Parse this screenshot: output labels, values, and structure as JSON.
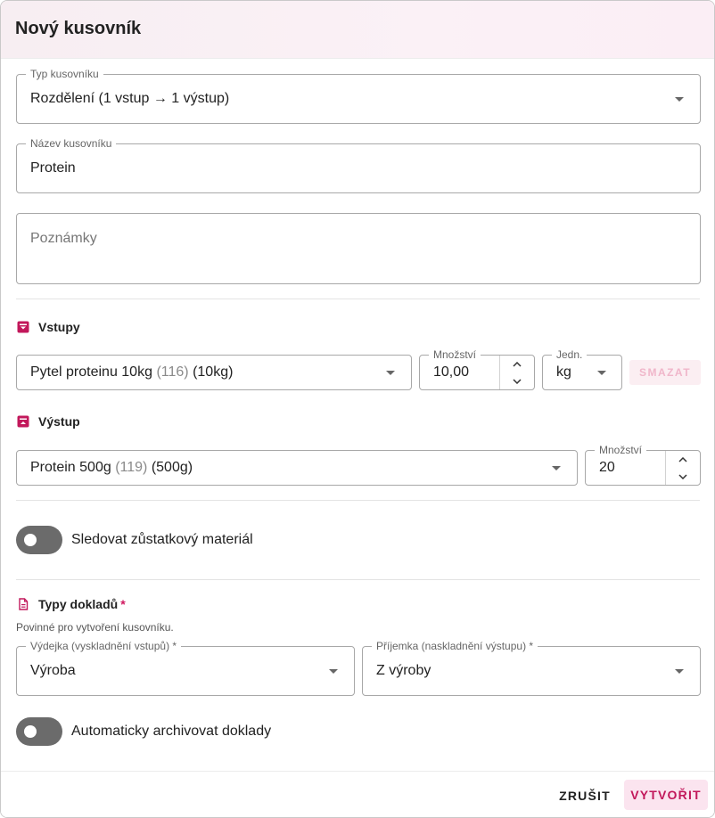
{
  "dialog": {
    "title": "Nový kusovník"
  },
  "bom_type": {
    "label": "Typ kusovníku",
    "value": "Rozdělení (1 vstup → 1 výstup)"
  },
  "bom_name": {
    "label": "Název kusovníku",
    "value": "Protein"
  },
  "notes": {
    "placeholder": "Poznámky"
  },
  "inputs": {
    "heading": "Vstupy",
    "item": {
      "product": "Pytel proteinu 10kg",
      "code": "(116)",
      "pack": "(10kg)",
      "quantity_label": "Množství",
      "quantity": "10,00",
      "unit_label": "Jedn.",
      "unit": "kg",
      "delete_label": "SMAZAT"
    }
  },
  "output": {
    "heading": "Výstup",
    "item": {
      "product": "Protein 500g",
      "code": "(119)",
      "pack": "(500g)",
      "quantity_label": "Množství",
      "quantity": "20"
    }
  },
  "track_remainder": {
    "label": "Sledovat zůstatkový materiál",
    "enabled": false
  },
  "doc_types": {
    "heading": "Typy dokladů",
    "required_mark": "*",
    "hint": "Povinné pro vytvoření kusovníku.",
    "issue": {
      "label": "Výdejka (vyskladnění vstupů) *",
      "value": "Výroba"
    },
    "receipt": {
      "label": "Příjemka (naskladnění výstupu) *",
      "value": "Z výroby"
    }
  },
  "auto_archive": {
    "label": "Automaticky archivovat doklady",
    "enabled": false
  },
  "footer": {
    "cancel": "ZRUŠIT",
    "create": "VYTVOŘIT"
  },
  "colors": {
    "accent": "#c2185b",
    "accent_light": "#fbe4ef",
    "toggle_off": "#6b6b6b"
  }
}
